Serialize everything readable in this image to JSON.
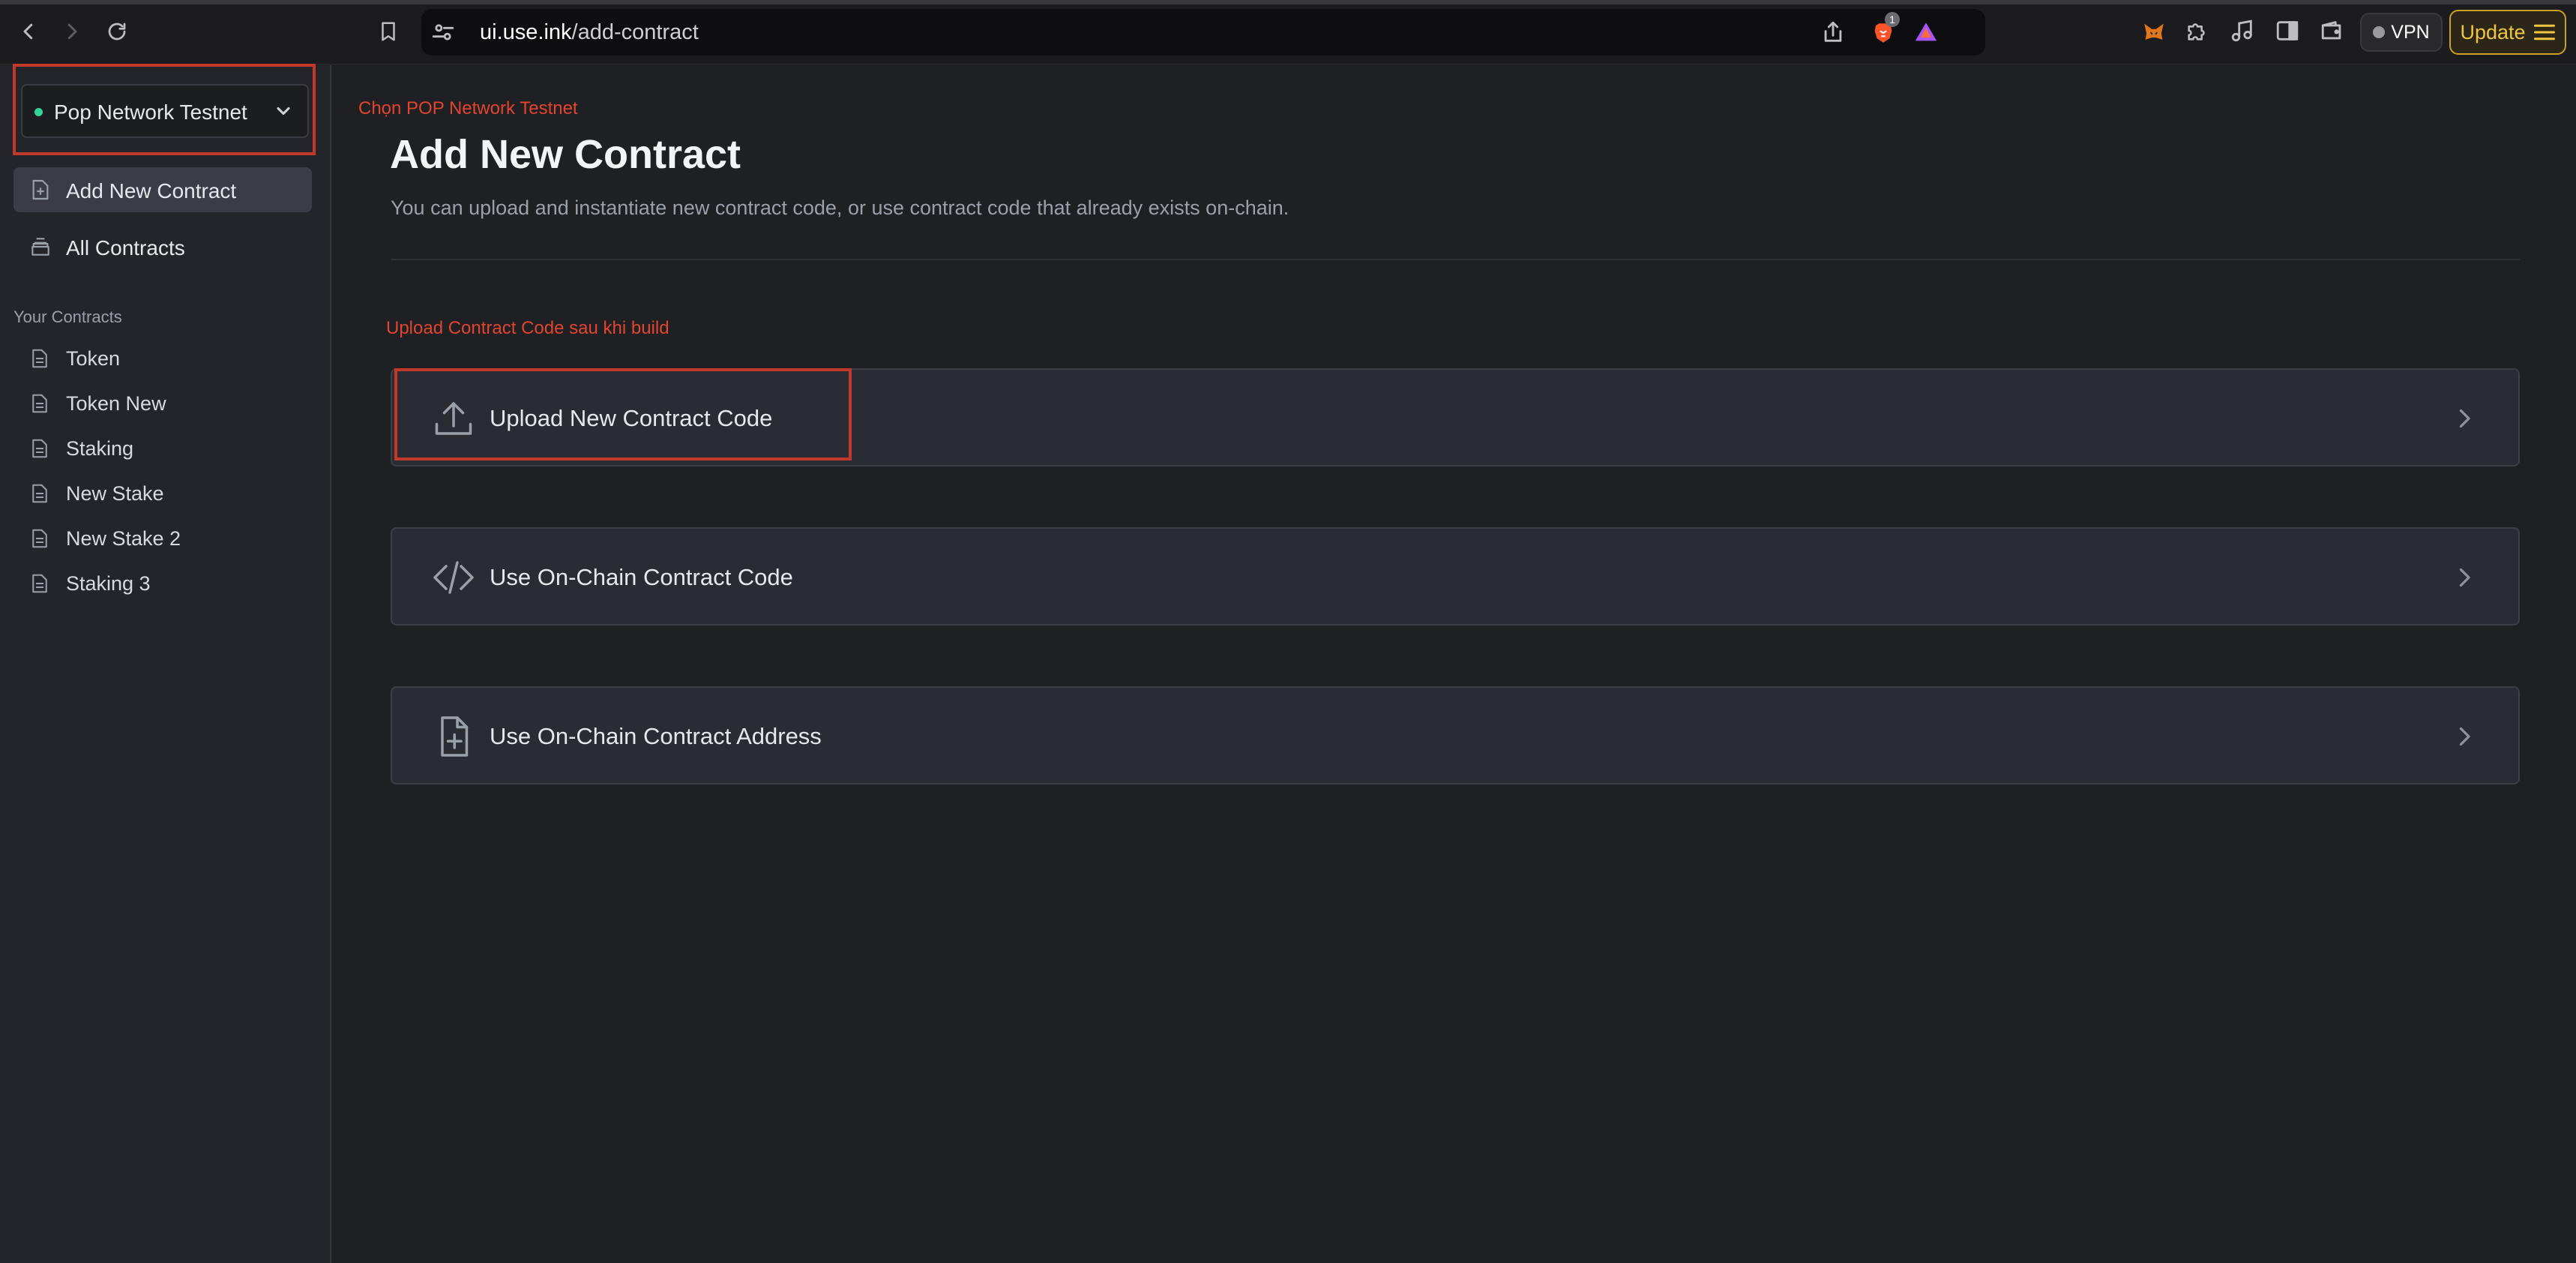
{
  "browser": {
    "url_host": "ui.use.ink",
    "url_path": "/add-contract",
    "shield_badge": "1",
    "vpn_label": "VPN",
    "update_label": "Update"
  },
  "sidebar": {
    "network": "Pop Network Testnet",
    "nav": [
      {
        "label": "Add New Contract",
        "icon": "add-file-icon",
        "active": true
      },
      {
        "label": "All Contracts",
        "icon": "stack-icon",
        "active": false
      }
    ],
    "section_title": "Your Contracts",
    "contracts": [
      "Token",
      "Token New",
      "Staking",
      "New Stake",
      "New Stake 2",
      "Staking 3"
    ]
  },
  "annotations": {
    "network_note": "Chọn POP Network Testnet",
    "upload_note": "Upload Contract Code sau khi build",
    "color": "#e2442f"
  },
  "main": {
    "title": "Add New Contract",
    "description": "You can upload and instantiate new contract code, or use contract code that already exists on-chain.",
    "options": [
      {
        "label": "Upload New Contract Code",
        "icon": "upload-icon"
      },
      {
        "label": "Use On-Chain Contract Code",
        "icon": "code-icon"
      },
      {
        "label": "Use On-Chain Contract Address",
        "icon": "file-plus-icon"
      }
    ]
  },
  "colors": {
    "background": "#1f2023",
    "sidebar": "#24252a",
    "card": "#2a2c33",
    "network_dot": "#34d399",
    "update_accent": "#f0c541"
  }
}
